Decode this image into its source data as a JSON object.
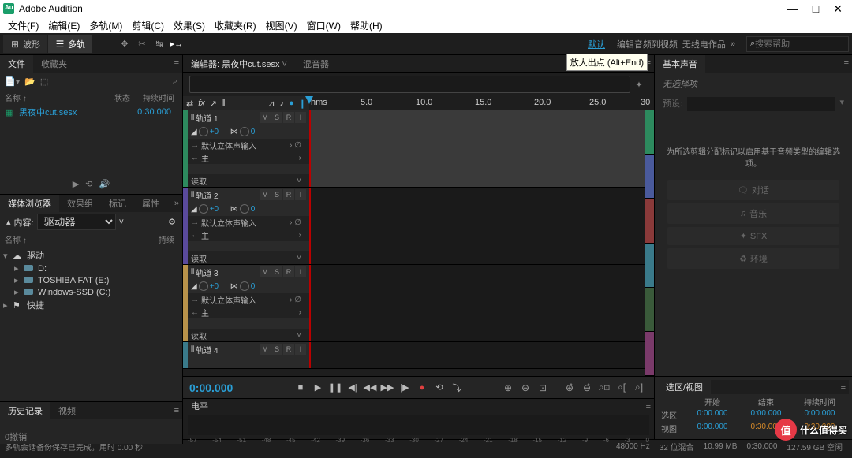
{
  "app": {
    "title": "Adobe Audition"
  },
  "menu": [
    "文件(F)",
    "编辑(E)",
    "多轨(M)",
    "剪辑(C)",
    "效果(S)",
    "收藏夹(R)",
    "视图(V)",
    "窗口(W)",
    "帮助(H)"
  ],
  "toolbar": {
    "waveform": "波形",
    "multitrack": "多轨",
    "default": "默认",
    "edit_audio": "编辑音频到视频",
    "radio": "无线电作品",
    "search": "搜索帮助"
  },
  "panels": {
    "files": "文件",
    "favorites": "收藏夹",
    "media": "媒体浏览器",
    "effects": "效果组",
    "markers": "标记",
    "properties": "属性",
    "history": "历史记录",
    "video": "视频"
  },
  "files": {
    "headers": {
      "name": "名称 ↑",
      "status": "状态",
      "duration": "持续时间"
    },
    "rows": [
      {
        "name": "黑夜中cut.sesx",
        "dur": "0:30.000"
      }
    ]
  },
  "media": {
    "content": "内容:",
    "drive": "驱动器",
    "name": "名称 ↑",
    "dur": "持续",
    "root": "驱动",
    "quick": "快捷",
    "items": [
      "D:",
      "TOSHIBA FAT (E:)",
      "Windows-SSD (C:)"
    ]
  },
  "editor": {
    "tab1_prefix": "编辑器:",
    "tab1_name": "黑夜中cut.sesx",
    "tab2": "混音器"
  },
  "ruler": [
    "hms",
    "5.0",
    "10.0",
    "15.0",
    "20.0",
    "25.0",
    "30"
  ],
  "tracks": [
    {
      "name": "轨道 1",
      "color": "#2d8a5e",
      "vol": "+0",
      "pan": "0",
      "input": "默认立体声输入",
      "bus": "主",
      "mode": "读取",
      "clip": true
    },
    {
      "name": "轨道 2",
      "color": "#5a4a9c",
      "vol": "+0",
      "pan": "0",
      "input": "默认立体声输入",
      "bus": "主",
      "mode": "读取",
      "clip": false
    },
    {
      "name": "轨道 3",
      "color": "#b8924a",
      "vol": "+0",
      "pan": "0",
      "input": "默认立体声输入",
      "bus": "主",
      "mode": "读取",
      "clip": false
    },
    {
      "name": "轨道 4",
      "color": "#3a7a8a",
      "vol": "+0",
      "pan": "0",
      "input": "",
      "bus": "",
      "mode": "",
      "clip": false
    }
  ],
  "track_labels": {
    "m": "M",
    "s": "S",
    "r": "R",
    "i": "I"
  },
  "transport": {
    "timecode": "0:00.000"
  },
  "tooltip": "放大出点 (Alt+End)",
  "levels": {
    "tab": "电平",
    "scale": [
      "-57",
      "-54",
      "-51",
      "-48",
      "-45",
      "-42",
      "-39",
      "-36",
      "-33",
      "-30",
      "-27",
      "-24",
      "-21",
      "-18",
      "-15",
      "-12",
      "-9",
      "-6",
      "-3",
      "0"
    ]
  },
  "essential": {
    "title": "基本声音",
    "no_sel": "无选择项",
    "preset": "预设:",
    "info": "为所选剪辑分配标记以启用基于音频类型的编辑选项。",
    "buttons": [
      {
        "icon": "🗨",
        "label": "对话"
      },
      {
        "icon": "♫",
        "label": "音乐"
      },
      {
        "icon": "✦",
        "label": "SFX"
      },
      {
        "icon": "♻",
        "label": "环境"
      }
    ]
  },
  "selection": {
    "title": "选区/视图",
    "headers": [
      "",
      "开始",
      "结束",
      "持续时间"
    ],
    "rows": [
      [
        "选区",
        "0:00.000",
        "0:00.000",
        "0:00.000"
      ],
      [
        "视图",
        "0:00.000",
        "0:30.000",
        "0:30.000"
      ]
    ]
  },
  "history": {
    "undo": "0撤销"
  },
  "status": {
    "msg": "多轨会话备份保存已完成，用时 0.00 秒",
    "right": [
      "48000 Hz",
      "32 位混合",
      "10.99 MB",
      "0:30.000",
      "127.59 GB 空闲"
    ]
  }
}
